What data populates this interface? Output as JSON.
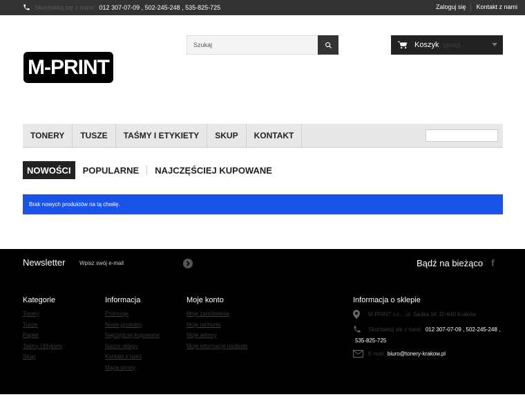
{
  "topbar": {
    "contact_label": "Skontaktuj się z nami:",
    "phones": "012 307-07-09 , 502-245-248 , 535-825-725",
    "login": "Zaloguj się",
    "contact_link": "Kontakt z nami"
  },
  "logo": {
    "text": "M-PRINT"
  },
  "search": {
    "placeholder": "Szukaj"
  },
  "cart": {
    "label": "Koszyk",
    "status": "(pusty)"
  },
  "nav": {
    "items": [
      "TONERY",
      "TUSZE",
      "TAŚMY I ETYKIETY",
      "SKUP",
      "KONTAKT"
    ]
  },
  "tabs": [
    "NOWOŚCI",
    "POPULARNE",
    "NAJCZĘŚCIEJ KUPOWANE"
  ],
  "alert": {
    "message": "Brak nowych produktów na tą chwilę."
  },
  "footer": {
    "newsletter_title": "Newsletter",
    "newsletter_placeholder": "Wpisz swój e-mail",
    "stay_updated": "Bądź na bieżąco",
    "columns": [
      {
        "title": "Kategorie",
        "links": [
          "Tonery",
          "Tusze",
          "Papier",
          "Taśmy i Etykiety",
          "Skup"
        ]
      },
      {
        "title": "Informacja",
        "links": [
          "Promocje",
          "Nowe produkty",
          "Najczęściej kupowane",
          "Nasze sklepy",
          "Kontakt z nami",
          "Mapa strony"
        ]
      },
      {
        "title": "Moje konto",
        "links": [
          "Moje zamówienia",
          "Moje rachunki",
          "Moje adresy",
          "Moje informacje osobiste"
        ]
      }
    ],
    "store": {
      "title": "Informacja o sklepie",
      "address": "M-PRINT s.c. , ul. Sadka 1K 30-640 Kraków",
      "call_label": "Skontaktuj się z nami:",
      "phones_line1": "012 307-07-09 , 502-245-248 ,",
      "phones_line2": "535-825-725",
      "email_label": "E-mail:",
      "email": "biuro@tonery-krakow.pl"
    }
  }
}
